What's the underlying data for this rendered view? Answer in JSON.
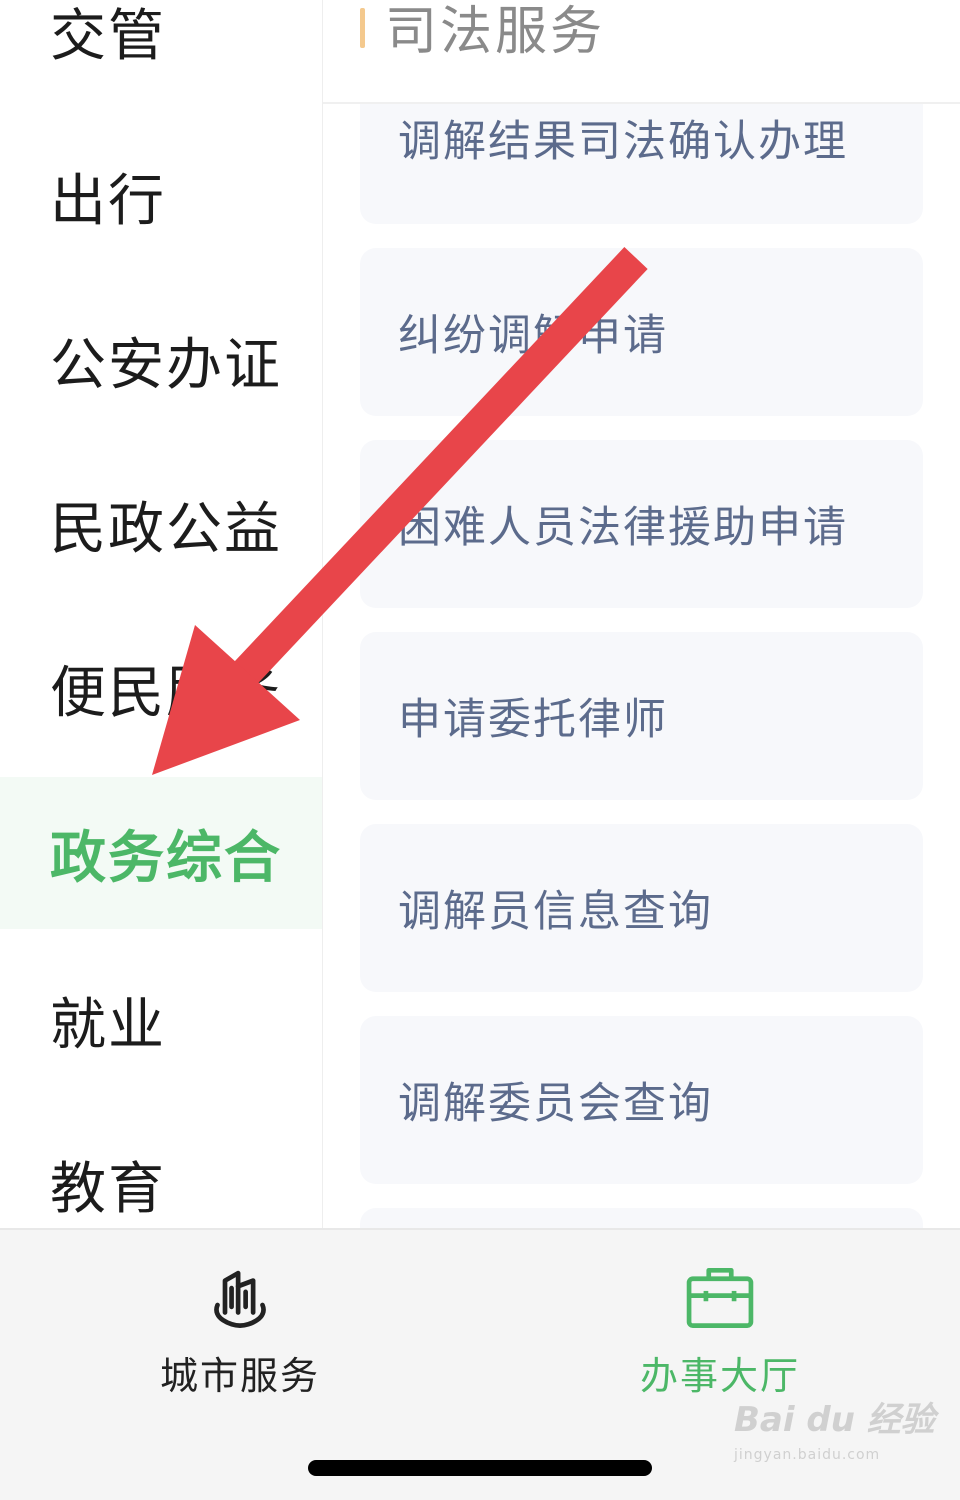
{
  "sidebar": {
    "items": [
      {
        "label": "交管"
      },
      {
        "label": "出行"
      },
      {
        "label": "公安办证"
      },
      {
        "label": "民政公益"
      },
      {
        "label": "便民服务"
      },
      {
        "label": "政务综合",
        "active": true
      },
      {
        "label": "就业"
      },
      {
        "label": "教育"
      }
    ]
  },
  "content": {
    "section_title": "司法服务",
    "cards": [
      {
        "label": "调解结果司法确认办理"
      },
      {
        "label": "纠纷调解申请"
      },
      {
        "label": "困难人员法律援助申请"
      },
      {
        "label": "申请委托律师"
      },
      {
        "label": "调解员信息查询"
      },
      {
        "label": "调解委员会查询"
      }
    ]
  },
  "tabbar": {
    "tabs": [
      {
        "label": "城市服务",
        "icon": "city-buildings-icon",
        "active": false
      },
      {
        "label": "办事大厅",
        "icon": "briefcase-icon",
        "active": true
      }
    ]
  },
  "annotation": {
    "arrow_color": "#e8454a",
    "watermark_main": "Bai du 经验",
    "watermark_sub": "jingyan.baidu.com"
  },
  "colors": {
    "accent_green": "#4cb767",
    "active_bg": "#f3faf5",
    "card_bg": "#f7f8fb",
    "card_text": "#5c6b8c",
    "section_bar": "#f4c98e"
  }
}
